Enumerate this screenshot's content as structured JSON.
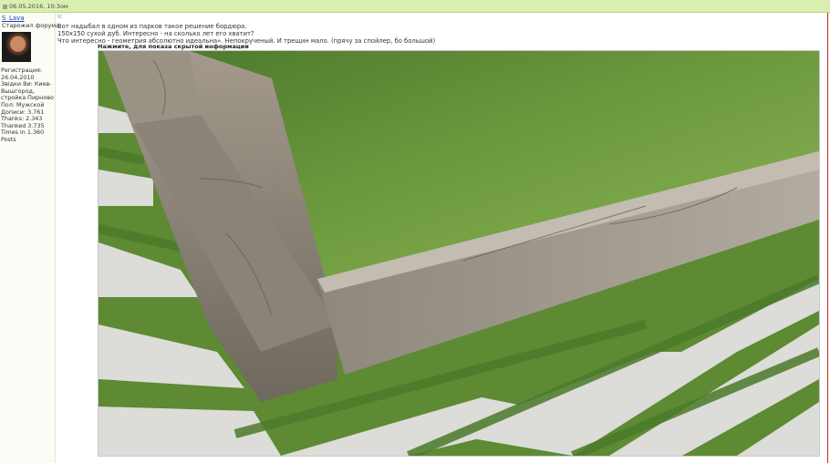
{
  "post_header": {
    "date": "06.05.2016, 10:3ом"
  },
  "user": {
    "name": "S_Lava",
    "title": "Старожил форума",
    "info": [
      "Регистрация:",
      "26.04.2010",
      "Звідки Ви: Киев-",
      "Вышгород,",
      "стройка Пирново",
      "Пол: Мужской",
      "Дописи: 3.761",
      "Thanks: 2.343",
      "Thanked 3.735",
      "Times in 1.360",
      "Posts"
    ]
  },
  "post": {
    "icon": "lc",
    "lines": [
      "Вот надыбал в одном из парков такое решение бордюра.",
      "150x150 сухой дуб. Интересно - на сколько лет его хватит?",
      "Что интересно - геометрия абсолютно идеальна». Непокрученый. И трещин мало. (прячу за спойлер, бо большой)"
    ],
    "spoiler_title": "Нажмите, для показа скрытой информации"
  },
  "photo": {
    "description_icon": "garden-photo"
  }
}
